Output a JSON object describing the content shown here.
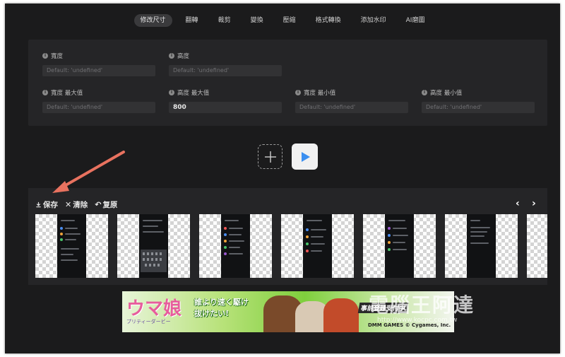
{
  "tabs": [
    "修改尺寸",
    "翻轉",
    "裁剪",
    "變換",
    "壓縮",
    "格式轉換",
    "添加水印",
    "AI磨圖"
  ],
  "active_tab": 0,
  "settings": {
    "width_label": "寬度",
    "height_label": "高度",
    "width_placeholder": "Default: 'undefined'",
    "height_placeholder": "Default: 'undefined'",
    "width_max_label": "寬度 最大值",
    "width_max_placeholder": "Default: 'undefined'",
    "height_max_label": "高度 最大值",
    "height_max_value": "800",
    "width_min_label": "寬度 最小值",
    "width_min_placeholder": "Default: 'undefined'",
    "height_min_label": "高度 最小值",
    "height_min_placeholder": "Default: 'undefined'"
  },
  "actions": {
    "add_icon": "plus-icon",
    "run_icon": "play-icon"
  },
  "gallery": {
    "save_label": "保存",
    "clear_label": "清除",
    "restore_label": "复原",
    "prev_icon": "chevron-left-icon",
    "next_icon": "chevron-right-icon",
    "thumbnail_count": 7
  },
  "ad": {
    "logo": "ウマ娘",
    "subtitle": "プリティーダービー",
    "headline": "誰より速く駆け抜けたい!",
    "tag": "事前登錄受付中",
    "brand": "DMM GAMES © Cygames, Inc."
  },
  "watermark": {
    "text": "電腦王阿達",
    "url": "http://www.kocpc.com.tw"
  },
  "colors": {
    "background": "#1b1b1c",
    "panel": "#252527",
    "input": "#323234",
    "play_icon": "#3b8ff0",
    "arrow": "#e8725f"
  }
}
